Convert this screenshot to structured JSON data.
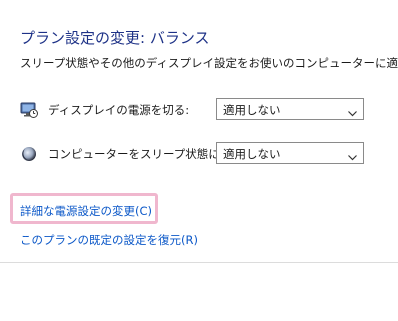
{
  "header": {
    "title": "プラン設定の変更: バランス",
    "subtitle": "スリープ状態やその他のディスプレイ設定をお使いのコンピューターに適用するまでの時"
  },
  "settings": [
    {
      "label": "ディスプレイの電源を切る:",
      "icon": "display-power-icon",
      "value": "適用しない"
    },
    {
      "label": "コンピューターをスリープ状態にする:",
      "icon": "sleep-moon-icon",
      "value": "適用しない"
    }
  ],
  "links": {
    "advanced": "詳細な電源設定の変更(C)",
    "restore": "このプランの既定の設定を復元(R)"
  },
  "colors": {
    "title": "#1e3287",
    "link": "#0c58c8",
    "highlight": "#f0b7ce"
  }
}
